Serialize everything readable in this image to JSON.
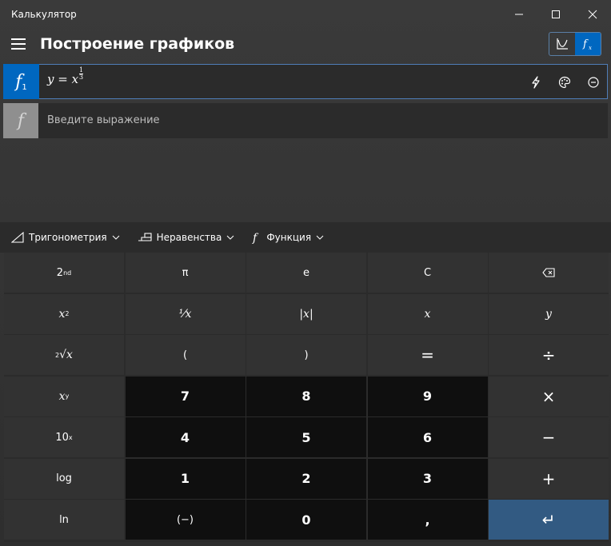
{
  "window": {
    "app_title": "Калькулятор"
  },
  "header": {
    "title": "Построение графиков"
  },
  "functions": [
    {
      "badge": "f",
      "index": "1",
      "expr_prefix": "y = x",
      "exp_num": "1",
      "exp_den": "3"
    },
    {
      "badge": "f",
      "placeholder": "Введите выражение"
    }
  ],
  "toolbar": {
    "trig": "Тригонометрия",
    "inequalities": "Неравенства",
    "function": "Функция"
  },
  "keys": {
    "second": "2",
    "second_sup": "nd",
    "pi": "π",
    "e": "e",
    "clear": "C",
    "x_squared_base": "x",
    "x_squared_sup": "2",
    "reciprocal": "⅟x",
    "abs": "|x|",
    "var_x": "x",
    "var_y": "y",
    "root_index": "2",
    "root_body": "√x",
    "lparen": "(",
    "rparen": ")",
    "equals": "=",
    "divide": "÷",
    "xy_base": "x",
    "xy_sup": "y",
    "seven": "7",
    "eight": "8",
    "nine": "9",
    "multiply": "×",
    "ten_base": "10",
    "ten_sup": "x",
    "four": "4",
    "five": "5",
    "six": "6",
    "minus": "−",
    "log": "log",
    "one": "1",
    "two": "2",
    "three": "3",
    "plus": "+",
    "ln": "ln",
    "negate": "(−)",
    "zero": "0",
    "comma": ",",
    "enter": "↵"
  },
  "colors": {
    "accent": "#0067c0",
    "enter_key": "#325a82",
    "digit_key": "#0f0f0f",
    "function_key": "#323232"
  },
  "icons": {
    "backspace": "backspace-icon",
    "analyze": "lightning-icon",
    "style": "palette-icon",
    "remove": "minus-circle-icon"
  }
}
